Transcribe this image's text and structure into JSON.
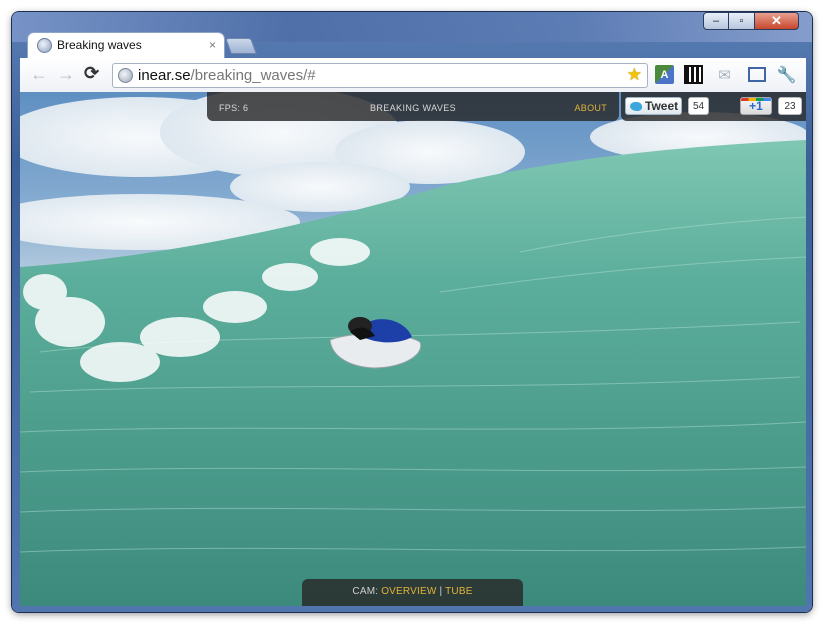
{
  "window": {
    "controls": {
      "minimize": "–",
      "maximize": "▫",
      "close": "✕"
    }
  },
  "tabs": [
    {
      "title": "Breaking waves",
      "close": "×"
    }
  ],
  "toolbar": {
    "back": "←",
    "forward": "→",
    "reload": "⟳",
    "url_host": "inear.se",
    "url_path": "/breaking_waves/#",
    "bookmark_star": "★",
    "translate_icon": "A",
    "mail_icon": "✉",
    "wrench_icon": "🔧"
  },
  "hud": {
    "fps": "FPS: 6",
    "title": "BREAKING WAVES",
    "about": "ABOUT"
  },
  "social": {
    "tweet_label": "Tweet",
    "tweet_count": "54",
    "plusone_label": "+1",
    "plusone_count": "23"
  },
  "cam": {
    "prefix": "CAM: ",
    "overview": "OVERVIEW",
    "separator": " | ",
    "tube": "TUBE"
  },
  "colors": {
    "accent": "#e0b43a",
    "hud_bg": "#2a2a2a",
    "water": "#4a9a8a",
    "sky": "#86acd1"
  }
}
